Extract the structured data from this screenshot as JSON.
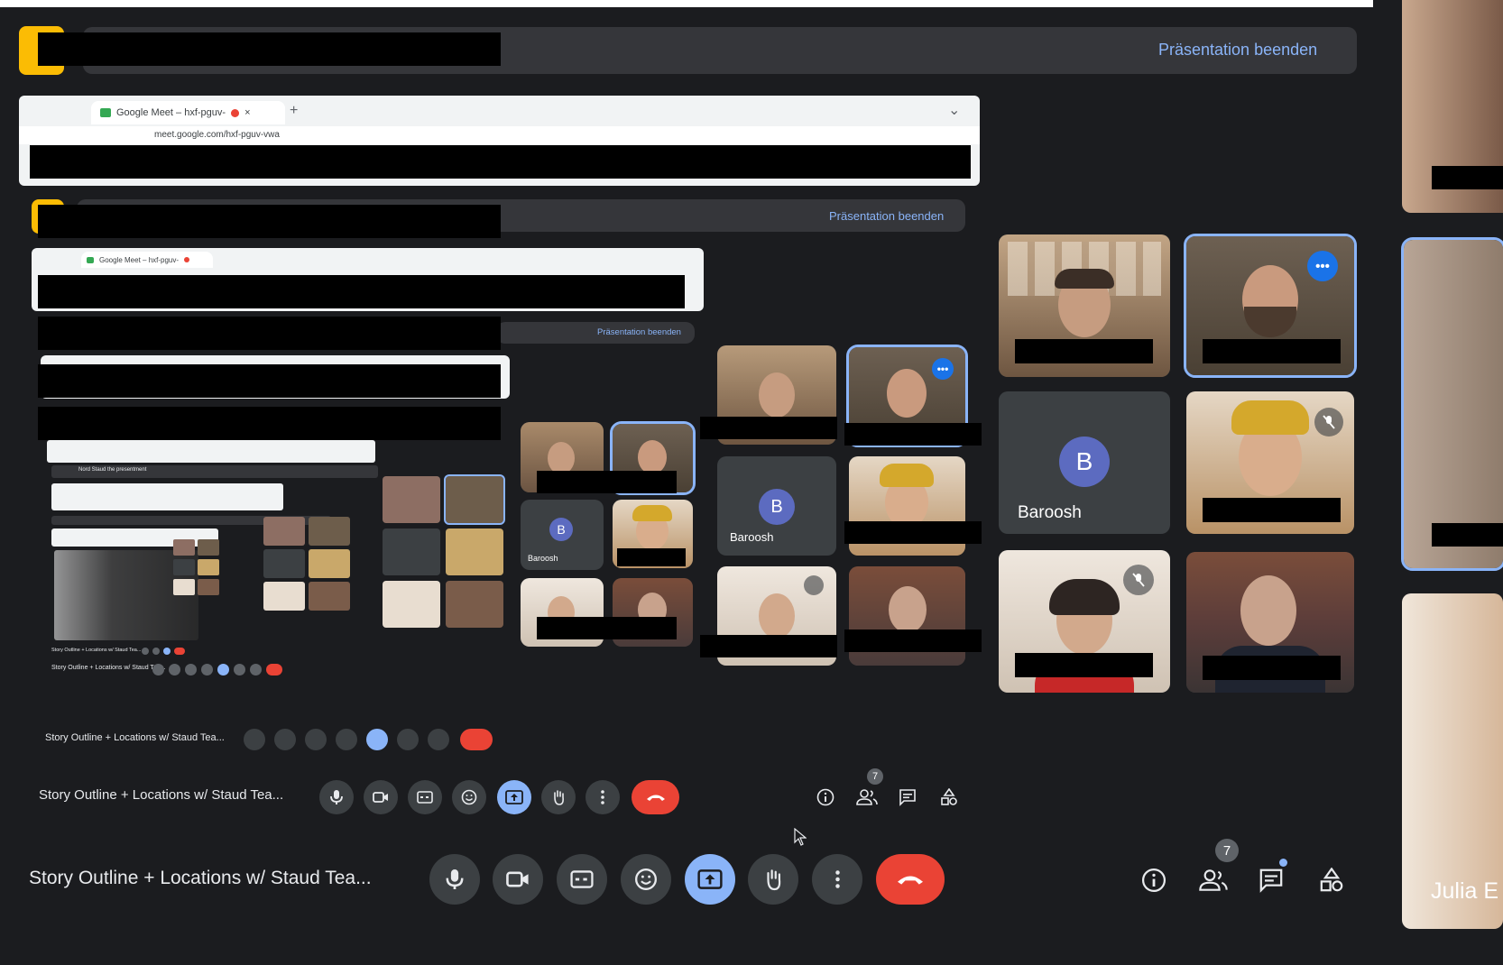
{
  "presentation": {
    "end_label": "Präsentation beenden"
  },
  "browser": {
    "tab_title": "Google Meet – hxf-pguv-",
    "tab_title_small": "Google Meet – hxf-pguv-",
    "url": "meet.google.com/hxf-pguv-vwa",
    "new_tab": "+",
    "close_tab": "×",
    "dropdown": "⌄"
  },
  "participants": {
    "baroosh_initial": "B",
    "baroosh_name": "Baroosh",
    "julia_name": "Julia E"
  },
  "meeting": {
    "title": "Story Outline + Locations w/ Staud Tea...",
    "people_count": "7"
  },
  "nested": {
    "title_small": "Story Outline + Locations w/ Staud Tea...",
    "tiny_title": "Story Outline + Locations w/ Staud Tea...",
    "micro_title": "Story Outline + Locations w/ Staud Tea...",
    "heading_tiny": "Nord Staud the presentment",
    "end_small": "Präsentation beenden"
  },
  "colors": {
    "background": "#1b1c1f",
    "accent": "#8ab4f8",
    "end_call": "#ea4335",
    "tile": "#3c4043"
  },
  "icons": [
    "mic-icon",
    "camera-icon",
    "captions-icon",
    "emoji-icon",
    "present-icon",
    "raise-hand-icon",
    "more-vert-icon",
    "end-call-icon",
    "info-icon",
    "people-icon",
    "chat-icon",
    "activities-icon",
    "mic-off-icon"
  ]
}
